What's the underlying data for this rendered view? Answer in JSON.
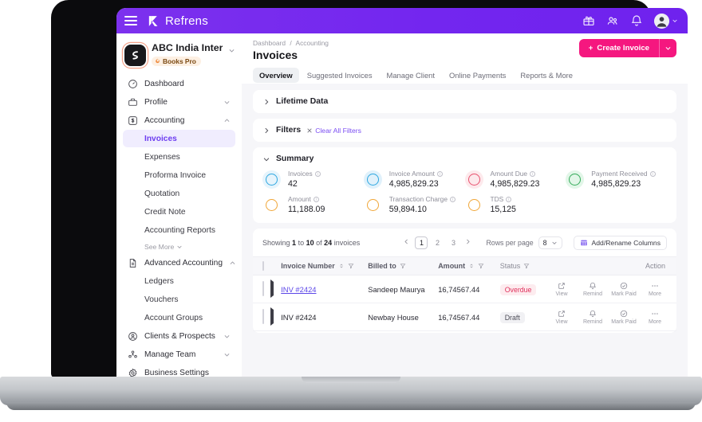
{
  "topbar": {
    "brand": "Refrens",
    "menu_icon": "hamburger-icon",
    "icons": [
      "gift-icon",
      "people-icon",
      "bell-icon"
    ],
    "avatar_icon": "user-avatar"
  },
  "sidebar": {
    "org_name": "ABC India Intern...",
    "org_badge": "Books Pro",
    "items": [
      {
        "label": "Dashboard",
        "icon": "speedometer-icon",
        "expandable": false
      },
      {
        "label": "Profile",
        "icon": "briefcase-icon",
        "expandable": true,
        "expanded": false
      },
      {
        "label": "Accounting",
        "icon": "dollar-box-icon",
        "expandable": true,
        "expanded": true
      }
    ],
    "accounting_sub": [
      {
        "label": "Invoices",
        "active": true
      },
      {
        "label": "Expenses",
        "active": false
      },
      {
        "label": "Proforma Invoice",
        "active": false
      },
      {
        "label": "Quotation",
        "active": false
      },
      {
        "label": "Credit Note",
        "active": false
      },
      {
        "label": "Accounting Reports",
        "active": false
      }
    ],
    "see_more": "See More",
    "advanced": {
      "label": "Advanced Accounting",
      "icon": "document-icon",
      "expanded": true
    },
    "advanced_sub": [
      {
        "label": "Ledgers"
      },
      {
        "label": "Vouchers"
      },
      {
        "label": "Account Groups"
      }
    ],
    "bottom_items": [
      {
        "label": "Clients & Prospects",
        "icon": "user-circle-icon",
        "expandable": true
      },
      {
        "label": "Manage Team",
        "icon": "team-icon",
        "expandable": true
      },
      {
        "label": "Business Settings",
        "icon": "gear-icon",
        "expandable": false
      }
    ]
  },
  "header": {
    "breadcrumb": [
      "Dashboard",
      "Accounting"
    ],
    "breadcrumb_separator": "/",
    "title": "Invoices",
    "create_button": "Create Invoice",
    "create_plus": "+",
    "create_caret_icon": "chevron-down-icon",
    "accent_pink": "#f5177f"
  },
  "tabs": [
    {
      "label": "Overview",
      "active": true
    },
    {
      "label": "Suggested Invoices",
      "active": false
    },
    {
      "label": "Manage Client",
      "active": false
    },
    {
      "label": "Online Payments",
      "active": false
    },
    {
      "label": "Reports & More",
      "active": false
    }
  ],
  "panels": {
    "lifetime_data": {
      "title": "Lifetime Data",
      "expanded": false
    },
    "filters": {
      "title": "Filters",
      "expanded": false,
      "clear_label": "Clear All Filters",
      "clear_icon": "close-icon"
    },
    "summary": {
      "title": "Summary",
      "expanded": true
    }
  },
  "metrics": [
    {
      "label": "Invoices",
      "value": "42",
      "color": "#2ea7e0",
      "glow": "#e6f4fc"
    },
    {
      "label": "Invoice Amount",
      "value": "4,985,829.23",
      "color": "#2ea7e0",
      "glow": "#e0f1fb"
    },
    {
      "label": "Amount Due",
      "value": "4,985,829.23",
      "color": "#e8526f",
      "glow": "#fde9ec"
    },
    {
      "label": "Payment Received",
      "value": "4,985,829.23",
      "color": "#35ab5a",
      "glow": "#e2f6e8"
    },
    {
      "label": "Amount",
      "value": "11,188.09",
      "color": "#f0a638",
      "glow": "#fdf2e2"
    },
    {
      "label": "Transaction Charge",
      "value": "59,894.10",
      "color": "#f0a638",
      "glow": "#fdf2e2"
    },
    {
      "label": "TDS",
      "value": "15,125",
      "color": "#f0a638",
      "glow": "#fdf2e2"
    }
  ],
  "table_toolbar": {
    "showing_prefix": "Showing",
    "showing_from": "1",
    "showing_to_word": "to",
    "showing_to": "10",
    "showing_of_word": "of",
    "showing_total": "24",
    "showing_suffix": "invoices",
    "prev_icon": "chevron-left-icon",
    "next_icon": "chevron-right-icon",
    "pages": [
      "1",
      "2",
      "3"
    ],
    "active_page": "1",
    "rows_per_page_label": "Rows per page",
    "rows_per_page_value": "8",
    "add_columns_label": "Add/Rename Columns",
    "add_columns_icon": "grid-icon"
  },
  "table": {
    "columns": [
      {
        "label": "Invoice Number",
        "sortable": true,
        "filterable": true
      },
      {
        "label": "Billed to",
        "sortable": false,
        "filterable": true
      },
      {
        "label": "Amount",
        "sortable": true,
        "filterable": true
      },
      {
        "label": "Status",
        "sortable": false,
        "filterable": true
      },
      {
        "label": "Action",
        "sortable": false,
        "filterable": false
      }
    ],
    "rows": [
      {
        "invoice_number": "INV #2424",
        "is_link": true,
        "billed_to": "Sandeep Maurya",
        "amount": "16,74567.44",
        "status": "Overdue",
        "status_kind": "overdue"
      },
      {
        "invoice_number": "INV #2424",
        "is_link": false,
        "billed_to": "Newbay House",
        "amount": "16,74567.44",
        "status": "Draft",
        "status_kind": "draft"
      }
    ],
    "row_actions": [
      {
        "label": "View",
        "icon": "external-link-icon"
      },
      {
        "label": "Remind",
        "icon": "bell-icon"
      },
      {
        "label": "Mark Paid",
        "icon": "check-circle-icon"
      },
      {
        "label": "More",
        "icon": "ellipsis-icon"
      }
    ]
  }
}
